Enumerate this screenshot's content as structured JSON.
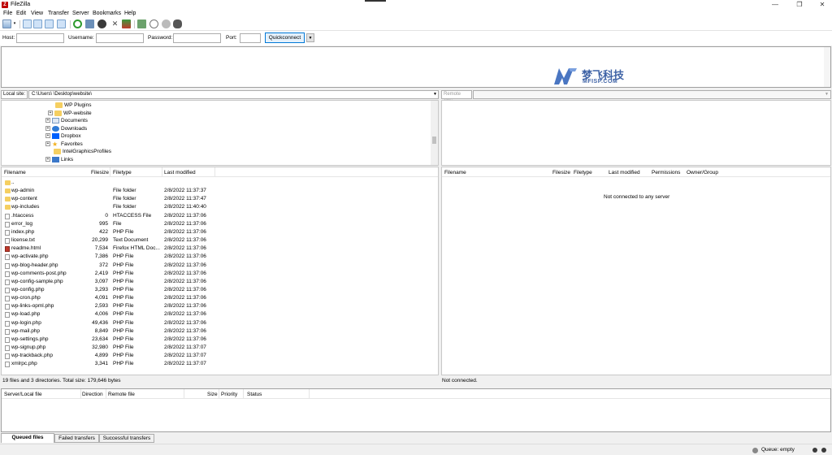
{
  "window": {
    "title": "FileZilla",
    "minimize": "—",
    "restore": "❐",
    "close": "✕"
  },
  "menu": [
    "File",
    "Edit",
    "View",
    "Transfer",
    "Server",
    "Bookmarks",
    "Help"
  ],
  "toolbar": {
    "icons": [
      "site-manager-icon",
      "toggle-message-log-icon",
      "toggle-local-tree-icon",
      "toggle-remote-tree-icon",
      "toggle-queue-icon",
      "refresh-icon",
      "process-queue-icon",
      "cancel-icon",
      "disconnect-icon",
      "reconnect-icon",
      "filter-icon",
      "toggle-sync-browsing-icon",
      "search-icon",
      "compare-icon"
    ]
  },
  "quickconnect": {
    "host_label": "Host:",
    "username_label": "Username:",
    "password_label": "Password:",
    "port_label": "Port:",
    "button": "Quickconnect",
    "host_value": "",
    "username_value": "",
    "password_value": "",
    "port_value": ""
  },
  "watermark": {
    "cn": "梦飞科技",
    "en": "MFISP.COM"
  },
  "local": {
    "site_label": "Local site:",
    "path": "C:\\Users\\        \\Desktop\\website\\",
    "tree": [
      {
        "label": "WP Plugins",
        "icon": "folder-icon",
        "expander": ""
      },
      {
        "label": "WP-website",
        "icon": "folder-icon",
        "expander": "+"
      },
      {
        "label": "Documents",
        "icon": "documents-icon",
        "expander": "+"
      },
      {
        "label": "Downloads",
        "icon": "downloads-icon",
        "expander": "+"
      },
      {
        "label": "Dropbox",
        "icon": "dropbox-icon",
        "expander": "+"
      },
      {
        "label": "Favorites",
        "icon": "favorites-icon",
        "expander": "+"
      },
      {
        "label": "IntelGraphicsProfiles",
        "icon": "folder-icon",
        "expander": ""
      },
      {
        "label": "Links",
        "icon": "links-icon",
        "expander": "+"
      }
    ],
    "columns": {
      "filename": "Filename",
      "filesize": "Filesize",
      "filetype": "Filetype",
      "modified": "Last modified"
    },
    "files": [
      {
        "name": "..",
        "size": "",
        "type": "",
        "modified": "",
        "kind": "folder"
      },
      {
        "name": "wp-admin",
        "size": "",
        "type": "File folder",
        "modified": "2/8/2022 11:37:37",
        "kind": "folder"
      },
      {
        "name": "wp-content",
        "size": "",
        "type": "File folder",
        "modified": "2/8/2022 11:37:47",
        "kind": "folder"
      },
      {
        "name": "wp-includes",
        "size": "",
        "type": "File folder",
        "modified": "2/8/2022 11:40:40",
        "kind": "folder"
      },
      {
        "name": ".htaccess",
        "size": "0",
        "type": "HTACCESS File",
        "modified": "2/8/2022 11:37:06",
        "kind": "file"
      },
      {
        "name": "error_log",
        "size": "995",
        "type": "File",
        "modified": "2/8/2022 11:37:06",
        "kind": "file"
      },
      {
        "name": "index.php",
        "size": "422",
        "type": "PHP File",
        "modified": "2/8/2022 11:37:06",
        "kind": "file"
      },
      {
        "name": "license.txt",
        "size": "20,299",
        "type": "Text Document",
        "modified": "2/8/2022 11:37:06",
        "kind": "file"
      },
      {
        "name": "readme.html",
        "size": "7,534",
        "type": "Firefox HTML Doc...",
        "modified": "2/8/2022 11:37:06",
        "kind": "html"
      },
      {
        "name": "wp-activate.php",
        "size": "7,386",
        "type": "PHP File",
        "modified": "2/8/2022 11:37:06",
        "kind": "file"
      },
      {
        "name": "wp-blog-header.php",
        "size": "372",
        "type": "PHP File",
        "modified": "2/8/2022 11:37:06",
        "kind": "file"
      },
      {
        "name": "wp-comments-post.php",
        "size": "2,419",
        "type": "PHP File",
        "modified": "2/8/2022 11:37:06",
        "kind": "file"
      },
      {
        "name": "wp-config-sample.php",
        "size": "3,097",
        "type": "PHP File",
        "modified": "2/8/2022 11:37:06",
        "kind": "file"
      },
      {
        "name": "wp-config.php",
        "size": "3,293",
        "type": "PHP File",
        "modified": "2/8/2022 11:37:06",
        "kind": "file"
      },
      {
        "name": "wp-cron.php",
        "size": "4,091",
        "type": "PHP File",
        "modified": "2/8/2022 11:37:06",
        "kind": "file"
      },
      {
        "name": "wp-links-opml.php",
        "size": "2,593",
        "type": "PHP File",
        "modified": "2/8/2022 11:37:06",
        "kind": "file"
      },
      {
        "name": "wp-load.php",
        "size": "4,006",
        "type": "PHP File",
        "modified": "2/8/2022 11:37:06",
        "kind": "file"
      },
      {
        "name": "wp-login.php",
        "size": "49,436",
        "type": "PHP File",
        "modified": "2/8/2022 11:37:06",
        "kind": "file"
      },
      {
        "name": "wp-mail.php",
        "size": "8,849",
        "type": "PHP File",
        "modified": "2/8/2022 11:37:06",
        "kind": "file"
      },
      {
        "name": "wp-settings.php",
        "size": "23,634",
        "type": "PHP File",
        "modified": "2/8/2022 11:37:06",
        "kind": "file"
      },
      {
        "name": "wp-signup.php",
        "size": "32,980",
        "type": "PHP File",
        "modified": "2/8/2022 11:37:07",
        "kind": "file"
      },
      {
        "name": "wp-trackback.php",
        "size": "4,899",
        "type": "PHP File",
        "modified": "2/8/2022 11:37:07",
        "kind": "file"
      },
      {
        "name": "xmlrpc.php",
        "size": "3,341",
        "type": "PHP File",
        "modified": "2/8/2022 11:37:07",
        "kind": "file"
      }
    ],
    "status": "19 files and 3 directories. Total size: 179,646 bytes"
  },
  "remote": {
    "site_label": "Remote site:",
    "path": "",
    "columns": {
      "filename": "Filename",
      "filesize": "Filesize",
      "filetype": "Filetype",
      "modified": "Last modified",
      "permissions": "Permissions",
      "owner": "Owner/Group"
    },
    "empty_message": "Not connected to any server",
    "status": "Not connected."
  },
  "queue": {
    "columns": {
      "server": "Server/Local file",
      "direction": "Direction",
      "remote": "Remote file",
      "size": "Size",
      "priority": "Priority",
      "status": "Status"
    },
    "tabs": [
      "Queued files",
      "Failed transfers",
      "Successful transfers"
    ],
    "status": "Queue: empty"
  }
}
